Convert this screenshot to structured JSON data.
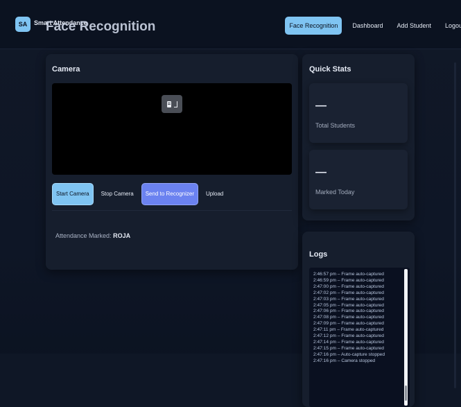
{
  "header": {
    "logo": "SA",
    "brand": "Smart Attendance",
    "page_title": "Face Recognition",
    "nav": [
      {
        "label": "Face Recognition",
        "active": true
      },
      {
        "label": "Dashboard"
      },
      {
        "label": "Add Student"
      },
      {
        "label": "Logout"
      }
    ]
  },
  "camera": {
    "title": "Camera",
    "buttons": {
      "start": "Start Camera",
      "stop": "Stop Camera",
      "send": "Send to Recognizer",
      "upload": "Upload"
    },
    "status_prefix": "Attendance Marked:",
    "status_name": "ROJA"
  },
  "stats": {
    "title": "Quick Stats",
    "total_value": "—",
    "total_label": "Total Students",
    "marked_value": "—",
    "marked_label": "Marked Today"
  },
  "logs": {
    "title": "Logs",
    "entries": [
      "2:46:57 pm – Frame auto-captured",
      "2:46:59 pm – Frame auto-captured",
      "2:47:00 pm – Frame auto-captured",
      "2:47:02 pm – Frame auto-captured",
      "2:47:03 pm – Frame auto-captured",
      "2:47:05 pm – Frame auto-captured",
      "2:47:06 pm – Frame auto-captured",
      "2:47:08 pm – Frame auto-captured",
      "2:47:09 pm – Frame auto-captured",
      "2:47:11 pm – Frame auto-captured",
      "2:47:12 pm – Frame auto-captured",
      "2:47:14 pm – Frame auto-captured",
      "2:47:15 pm – Frame auto-captured",
      "2:47:16 pm – Auto-capture stopped",
      "2:47:16 pm – Camera stopped"
    ]
  },
  "colors": {
    "accent": "#7fc4f2",
    "accent_alt": "#6b82f0",
    "background": "#0d1322",
    "card": "#161e2d"
  }
}
